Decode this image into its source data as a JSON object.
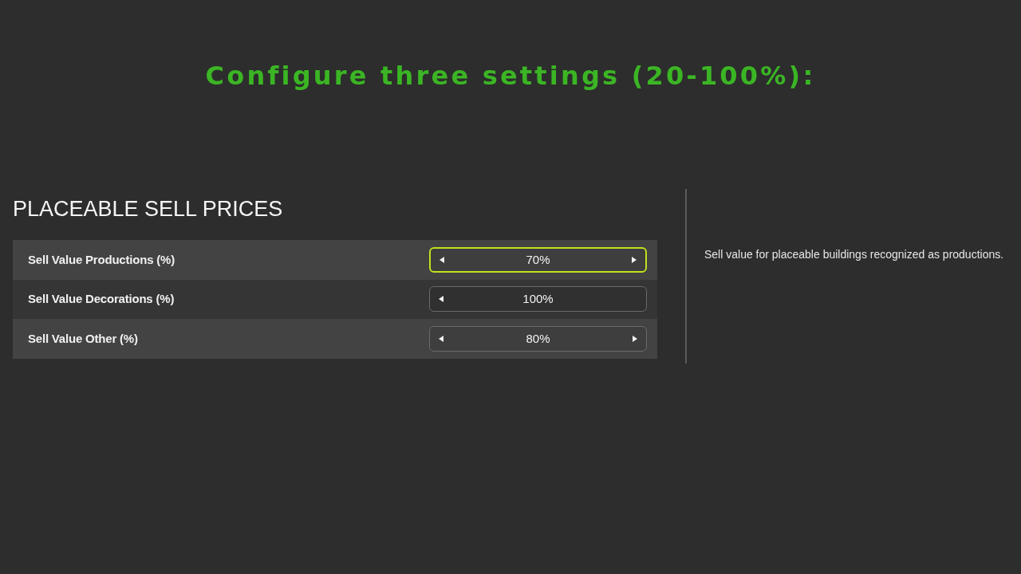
{
  "banner": {
    "title": "Configure three settings (20-100%):"
  },
  "section": {
    "heading": "PLACEABLE SELL PRICES",
    "settings": [
      {
        "label": "Sell Value Productions (%)",
        "value": "70%",
        "selected": true,
        "can_decrease": true,
        "can_increase": true
      },
      {
        "label": "Sell Value Decorations (%)",
        "value": "100%",
        "selected": false,
        "can_decrease": true,
        "can_increase": false
      },
      {
        "label": "Sell Value Other (%)",
        "value": "80%",
        "selected": false,
        "can_decrease": true,
        "can_increase": true
      }
    ]
  },
  "description": {
    "text": "Sell value for placeable buildings recognized as productions."
  }
}
